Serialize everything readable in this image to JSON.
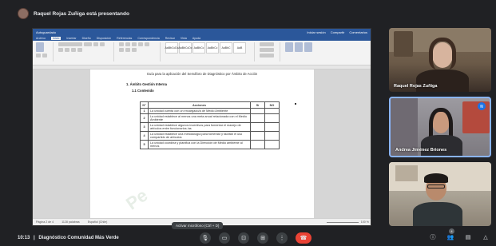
{
  "presenter": {
    "text": "Raquel Rojas Zuñiga está presentando"
  },
  "word": {
    "title_left": "Autoguardado",
    "title_right": [
      "Iniciar sesión",
      "Compartir",
      "Comentarios"
    ],
    "menu": [
      "Archivo",
      "Inicio",
      "Insertar",
      "Diseño",
      "Disposición",
      "Referencias",
      "Correspondencia",
      "Revisar",
      "Vista",
      "Ayuda"
    ],
    "active_menu": "Inicio",
    "styles": [
      "AaBbCcDc",
      "AaBbCcDc",
      "AaBbCc",
      "AaBbCc",
      "AaBbC",
      "AaB"
    ],
    "ribbon_groups": [
      "Portapapeles",
      "Fuente",
      "Párrafo",
      "Estilos",
      "Edición"
    ]
  },
  "document": {
    "heading": "Guía para la aplicación del Semáforo de Diagnóstico por Ámbito de Acción",
    "section": "1.   Ámbito Gestión Interna",
    "subsection": "1.1 Contenido",
    "columns": [
      "N°",
      "Acciones",
      "Sí",
      "NO"
    ],
    "rows": [
      {
        "n": "1",
        "text": "La unidad cuenta con un encargado/a de Medio Ambiente"
      },
      {
        "n": "2",
        "text": "La unidad establece al menos una meta anual relacionada con el Medio Ambiente"
      },
      {
        "n": "3",
        "text": "La unidad establece algunos incentivos para fomentar el manejo de artículos entre funcionarios /as"
      },
      {
        "n": "4",
        "text": "La unidad establece una metodología para fomentar y facilitar el uso compartido de artículos"
      },
      {
        "n": "5",
        "text": "La unidad coordina y planifica con la Dirección de Medio ambiente al menos"
      }
    ],
    "watermark": "Pe"
  },
  "statusbar": {
    "page": "Página 2 de 4",
    "words": "1128 palabras",
    "lang": "Español (Chile)",
    "zoom": "100 %"
  },
  "participants": [
    {
      "name": "Raquel Rojas Zuñiga"
    },
    {
      "name": "Andrea Jiménez Briones"
    },
    {
      "name": ""
    }
  ],
  "meeting": {
    "time": "10:13",
    "separator": "|",
    "title": "Diagnóstico Comunidad Más Verde",
    "tooltip": "Activar micrófono (Ctrl + D)",
    "participant_count": "4"
  },
  "colors": {
    "meet_bg": "#202124",
    "word_blue": "#2b579a",
    "hangup": "#ea4335",
    "active_border": "#8ab4f8"
  }
}
